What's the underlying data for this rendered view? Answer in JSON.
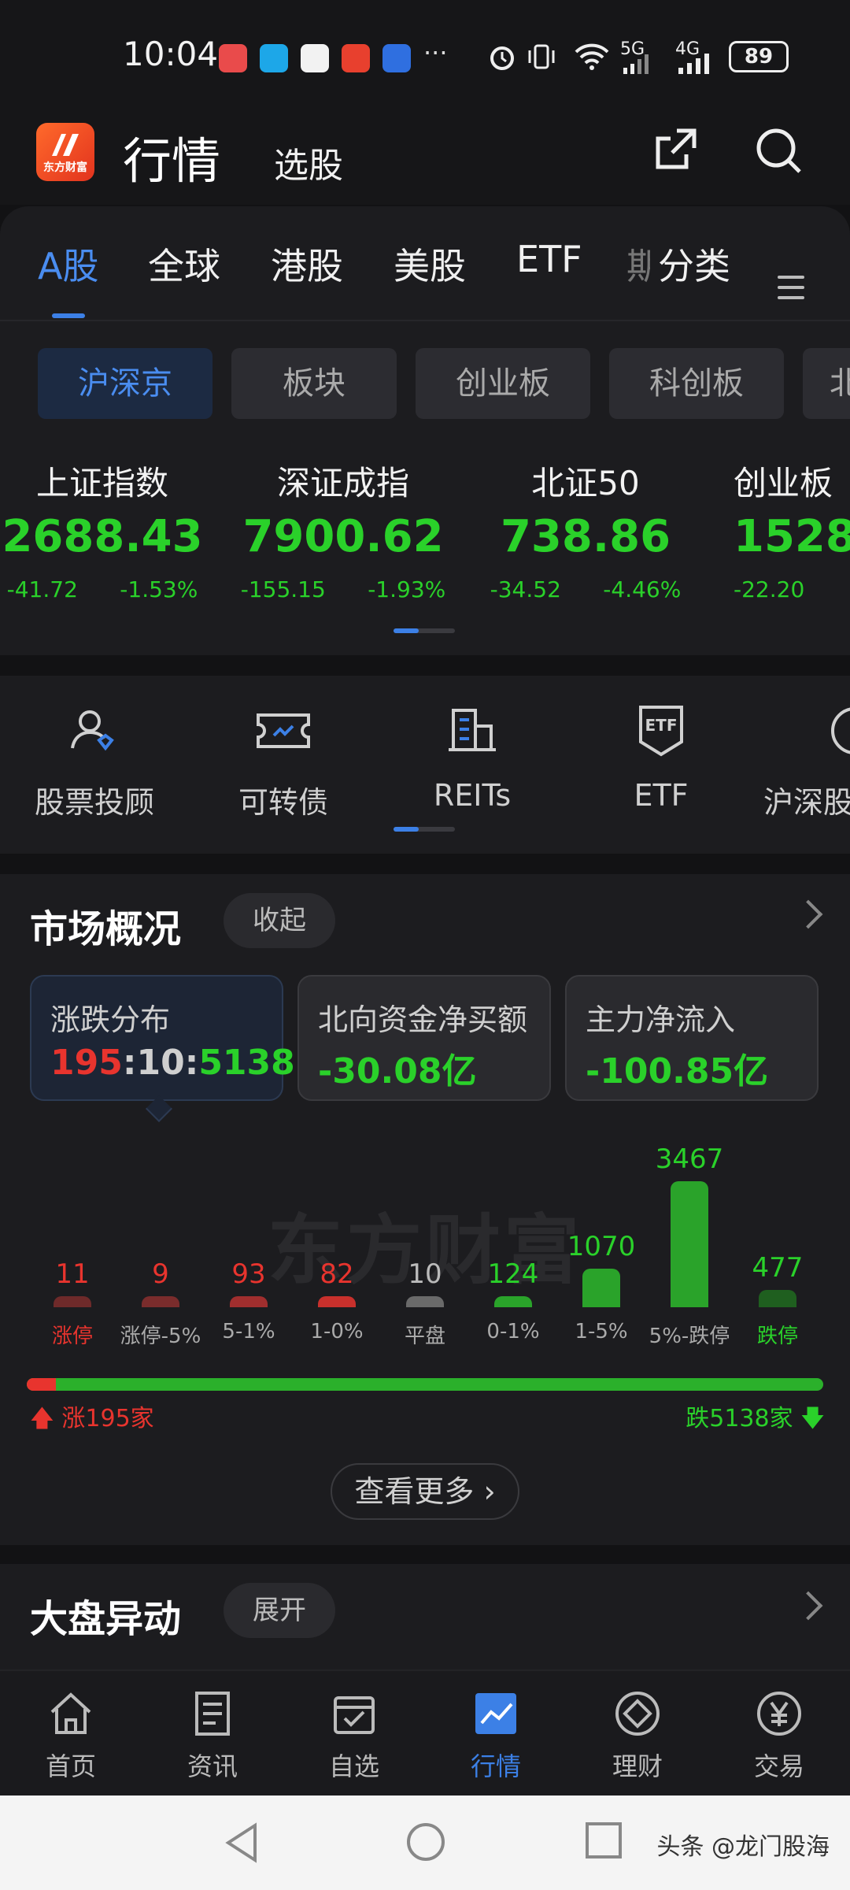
{
  "status": {
    "time": "10:04",
    "dots": "···",
    "signal_5g": "5G",
    "signal_4g": "4G",
    "battery": "89"
  },
  "header": {
    "brand": "东方财富",
    "title": "行情",
    "subtitle": "选股"
  },
  "tabs": [
    "A股",
    "全球",
    "港股",
    "美股",
    "ETF",
    "期",
    "分类"
  ],
  "chips": [
    "沪深京",
    "板块",
    "创业板",
    "科创板",
    "北"
  ],
  "indices": [
    {
      "name": "上证指数",
      "value": "2688.43",
      "change": "-41.72",
      "pct": "-1.53%"
    },
    {
      "name": "深证成指",
      "value": "7900.62",
      "change": "-155.15",
      "pct": "-1.93%"
    },
    {
      "name": "北证50",
      "value": "738.86",
      "change": "-34.52",
      "pct": "-4.46%"
    },
    {
      "name": "创业板",
      "value": "1528",
      "change": "-22.20",
      "pct": ""
    }
  ],
  "quick": [
    {
      "label": "股票投顾",
      "icon": "advisor-icon"
    },
    {
      "label": "可转债",
      "icon": "convertible-bond-icon"
    },
    {
      "label": "REITs",
      "icon": "reits-icon"
    },
    {
      "label": "ETF",
      "icon": "etf-icon"
    },
    {
      "label": "沪深股",
      "icon": "etf-icon"
    }
  ],
  "market": {
    "title": "市场概况",
    "collapse": "收起",
    "cards": [
      {
        "label": "涨跌分布",
        "up": "195",
        "flat": "10",
        "down": "5138"
      },
      {
        "label": "北向资金净买额",
        "value": "-30.08亿"
      },
      {
        "label": "主力净流入",
        "value": "-100.85亿"
      }
    ],
    "watermark": "东方财富",
    "rise_label": "涨195家",
    "fall_label": "跌5138家",
    "more": "查看更多",
    "up_count": 195,
    "down_count": 5138,
    "flat_count": 10
  },
  "chart_data": {
    "type": "bar",
    "categories": [
      "涨停",
      "涨停-5%",
      "5-1%",
      "1-0%",
      "平盘",
      "0-1%",
      "1-5%",
      "5%-跌停",
      "跌停"
    ],
    "values": [
      11,
      9,
      93,
      82,
      10,
      124,
      1070,
      3467,
      477
    ],
    "colors": [
      "#6e2a2a",
      "#7a2c2c",
      "#a02e2e",
      "#c8302c",
      "#6a6a6a",
      "#2aa32a",
      "#2aa32a",
      "#2aa32a",
      "#1f5f1f"
    ],
    "label_colors": [
      "#e8342e",
      "#e8342e",
      "#e8342e",
      "#e8342e",
      "#bbbbbb",
      "#2ad12a",
      "#2ad12a",
      "#2ad12a",
      "#2ad12a"
    ]
  },
  "anomaly": {
    "title": "大盘异动",
    "expand": "展开"
  },
  "nav": [
    "首页",
    "资讯",
    "自选",
    "行情",
    "理财",
    "交易"
  ],
  "credit": "头条 @龙门股海"
}
